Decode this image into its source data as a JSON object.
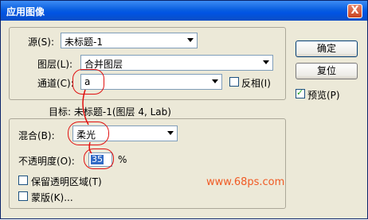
{
  "window": {
    "title": "应用图像",
    "close_label": "X"
  },
  "source": {
    "label": "源(S):",
    "value": "未标题-1"
  },
  "layer": {
    "label": "图层(L):",
    "value": "合并图层"
  },
  "channel": {
    "label": "通道(C):",
    "value": "a",
    "invert_label": "反相(I)",
    "invert_checked": false
  },
  "target": {
    "text": "目标:  未标题-1(图层 4, Lab)"
  },
  "blend": {
    "label": "混合(B):",
    "value": "柔光"
  },
  "opacity": {
    "label": "不透明度(O):",
    "value": "35",
    "unit": "%"
  },
  "preserve_transparency": {
    "label": "保留透明区域(T)",
    "checked": false
  },
  "mask": {
    "label": "蒙版(K)...",
    "checked": false
  },
  "buttons": {
    "ok": "确定",
    "reset": "复位"
  },
  "preview": {
    "label": "预览(P)",
    "checked": true
  },
  "watermark": "www.68ps.com"
}
